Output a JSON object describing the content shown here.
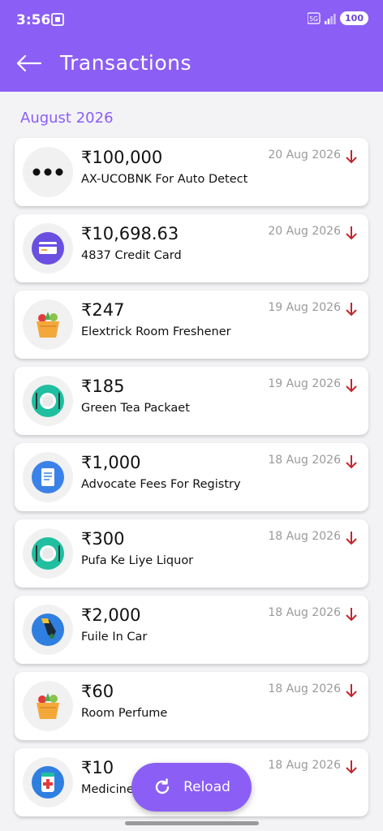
{
  "status_bar": {
    "time": "3:56",
    "network": "5G",
    "battery": "100"
  },
  "header": {
    "title": "Transactions",
    "back_icon": "arrow-left-icon"
  },
  "section": {
    "label": "August 2026"
  },
  "transactions": [
    {
      "amount": "₹100,000",
      "description": "AX-UCOBNK For Auto Detect",
      "date": "20 Aug 2026",
      "icon": "more-dots-icon",
      "direction": "debit"
    },
    {
      "amount": "₹10,698.63",
      "description": "4837 Credit Card",
      "date": "20 Aug 2026",
      "icon": "credit-card-icon",
      "direction": "debit"
    },
    {
      "amount": "₹247",
      "description": "Elextrick Room Freshener",
      "date": "19 Aug 2026",
      "icon": "grocery-basket-icon",
      "direction": "debit"
    },
    {
      "amount": "₹185",
      "description": "Green Tea Packaet",
      "date": "19 Aug 2026",
      "icon": "food-plate-icon",
      "direction": "debit"
    },
    {
      "amount": "₹1,000",
      "description": "Advocate Fees For Registry",
      "date": "18 Aug 2026",
      "icon": "document-icon",
      "direction": "debit"
    },
    {
      "amount": "₹300",
      "description": "Pufa Ke Liye Liquor",
      "date": "18 Aug 2026",
      "icon": "food-plate-icon",
      "direction": "debit"
    },
    {
      "amount": "₹2,000",
      "description": "Fuile In Car",
      "date": "18 Aug 2026",
      "icon": "fuel-pump-icon",
      "direction": "debit"
    },
    {
      "amount": "₹60",
      "description": "Room Perfume",
      "date": "18 Aug 2026",
      "icon": "grocery-basket-icon",
      "direction": "debit"
    },
    {
      "amount": "₹10",
      "description": "Medicine",
      "date": "18 Aug 2026",
      "icon": "medicine-icon",
      "direction": "debit"
    }
  ],
  "fab": {
    "label": "Reload",
    "icon": "refresh-icon"
  },
  "colors": {
    "primary": "#8b5ef5",
    "debit_arrow": "#c0262d",
    "section_text": "#8b5ef5"
  }
}
